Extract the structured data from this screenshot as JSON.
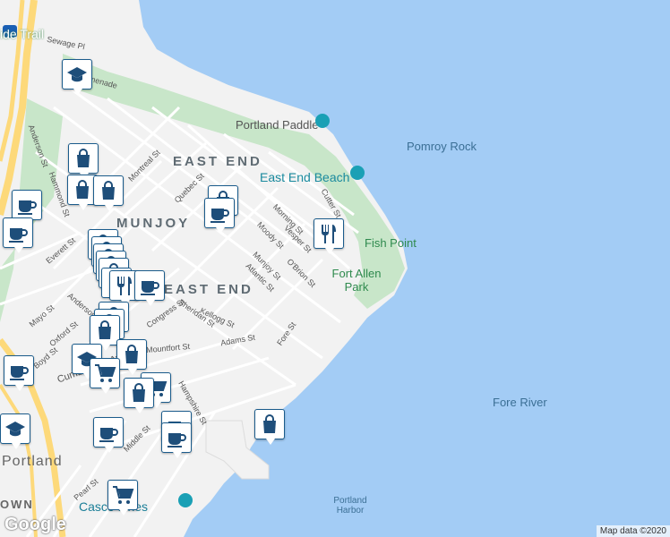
{
  "map": {
    "water_labels": [
      "Pomroy Rock",
      "Fore River",
      "Portland Harbor"
    ],
    "area_labels": [
      "EAST END",
      "MUNJOY",
      "EAST END"
    ],
    "park_labels": [
      "Portland Paddle",
      "East End Beach",
      "Fish Point",
      "Fort Allen Park"
    ],
    "city_label": "Portland",
    "downtown_label": "OWN",
    "trail_label": "ide Trail",
    "ferry_label": "Casco Lines",
    "ferry_prefix": "Casc",
    "highway_shield": "295",
    "streets": [
      "Sewage Pl",
      "Anderson St",
      "Hammond St",
      "Montreal St",
      "Quebec St",
      "Morning St",
      "Vesper St",
      "Moody St",
      "Munjoy St",
      "O'Brion St",
      "Atlantic St",
      "Cutter St",
      "Everett St",
      "Oxford St",
      "Mayo St",
      "Boyd St",
      "Kellogg St",
      "Sheridan St",
      "Congress St",
      "Adams St",
      "Fore St",
      "Mountfort St",
      "Middle St",
      "Pearl St",
      "Hampshire St",
      "Cumberland Ave",
      "Anderson St",
      "Promenade"
    ],
    "icon_types": {
      "cafe": "coffee-cup-icon",
      "shop": "shopping-bag-icon",
      "school": "graduation-cap-icon",
      "restaurant": "fork-knife-icon",
      "grocery": "shopping-cart-icon"
    },
    "colors": {
      "water": "#a3ccf5",
      "land": "#f2f2f2",
      "park": "#c8e6c9",
      "road": "#ffffff",
      "highway": "#fdd97a",
      "pin_border": "#1b5c8c",
      "icon": "#1e4e7a"
    }
  },
  "footer": {
    "google": "Google",
    "attribution": "Map data ©2020"
  }
}
